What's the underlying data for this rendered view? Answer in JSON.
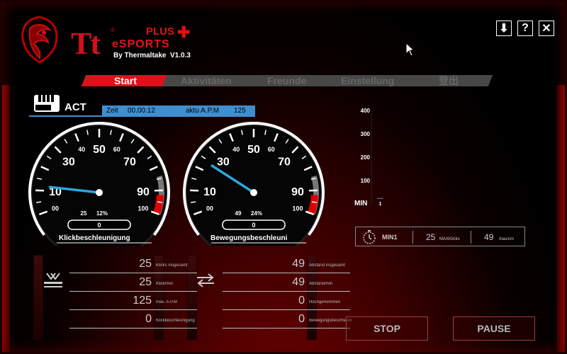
{
  "brand": {
    "tt": "Tt",
    "reg": "®",
    "plus": "PLUS",
    "plus_mark": "✚",
    "esports": "eSPORTS",
    "byline": "By Thermaltake",
    "version": "V1.0.3"
  },
  "window": {
    "download": "⬇",
    "help": "?",
    "close": "✕"
  },
  "tabs": [
    {
      "label": "Start"
    },
    {
      "label": "Aktivitäten"
    },
    {
      "label": "Freunde"
    },
    {
      "label": "Einstellung"
    },
    {
      "label": "登出"
    }
  ],
  "act": {
    "label": "ACT",
    "zeit_label": "Zeit",
    "zeit_value": "00.00.12",
    "apm_label": "aktu A.P.M",
    "apm_value": "125"
  },
  "gauge_ticks": [
    "00",
    "10",
    "30",
    "40",
    "50",
    "60",
    "70",
    "90",
    "100"
  ],
  "gauge_left": {
    "title": "Klickbeschleunigung",
    "readout_a": "25",
    "readout_b": "12%",
    "counter": "0",
    "needle_value": 12
  },
  "gauge_right": {
    "title": "Bewegungsbeschleuni",
    "readout_a": "49",
    "readout_b": "24%",
    "counter": "0",
    "needle_value": 24
  },
  "left_stats": [
    {
      "value": "25",
      "label": "Klicks insgesamt"
    },
    {
      "value": "25",
      "label": "Klick/min"
    },
    {
      "value": "125",
      "label": "max. A.P.M"
    },
    {
      "value": "0",
      "label": "Klickbeschleunigung"
    }
  ],
  "right_stats": [
    {
      "value": "49",
      "label": "Abstand insgesamt"
    },
    {
      "value": "49",
      "label": "Abstand/min"
    },
    {
      "value": "0",
      "label": "Hochgenommen"
    },
    {
      "value": "0",
      "label": "Bewegungsbeschleunigung"
    }
  ],
  "chart_data": {
    "type": "bar",
    "categories": [
      "1"
    ],
    "values": [
      25
    ],
    "title": "",
    "xlabel": "MIN",
    "ylabel": "",
    "ylim": [
      0,
      400
    ],
    "yticks": [
      "400",
      "300",
      "200",
      "100"
    ]
  },
  "min_panel": {
    "name": "MIN1",
    "value1": "25",
    "label1": "MAXKlicks",
    "value2": "49",
    "label2": "mas/cm"
  },
  "buttons": {
    "stop": "STOP",
    "pause": "PAUSE"
  },
  "colors": {
    "accent_red": "#e0101a",
    "accent_blue": "#3f8fcf",
    "needle": "#29a9e0"
  }
}
